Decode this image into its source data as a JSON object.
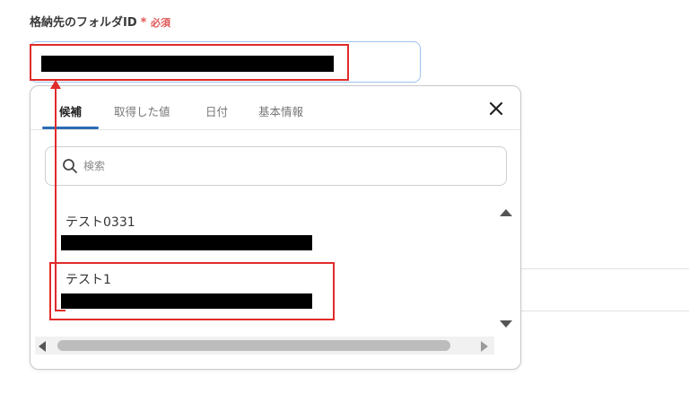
{
  "field": {
    "label": "格納先のフォルダID",
    "required_star": "*",
    "required_text": "必須"
  },
  "picker": {
    "tabs": [
      {
        "label": "候補",
        "active": true
      },
      {
        "label": "取得した値",
        "active": false
      },
      {
        "label": "日付",
        "active": false
      },
      {
        "label": "基本情報",
        "active": false
      }
    ],
    "close_icon": "close-icon",
    "search": {
      "placeholder": "検索",
      "icon": "search-icon"
    },
    "items": [
      {
        "label": "テスト0331"
      },
      {
        "label": "テスト1"
      }
    ]
  },
  "colors": {
    "highlight": "#e02b2b",
    "active_tab_underline": "#2b6cb6",
    "required": "#e05757"
  }
}
